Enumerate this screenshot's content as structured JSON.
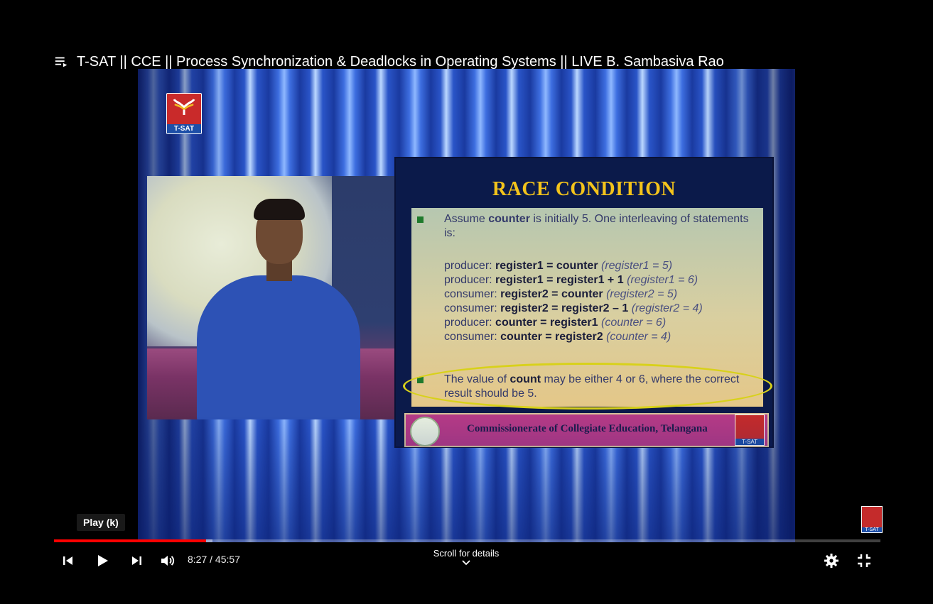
{
  "header": {
    "playlist_icon": "playlist-icon",
    "title": "T-SAT || CCE || Process Synchronization & Deadlocks in Operating Systems || LIVE B. Sambasiva Rao"
  },
  "video": {
    "channel_logo_label": "T-SAT",
    "slide": {
      "title": "RACE CONDITION",
      "intro_prefix": "Assume ",
      "intro_bold": "counter",
      "intro_suffix": " is initially 5. One interleaving of statements is:",
      "lines": [
        {
          "who": "producer: ",
          "stmt": "register1 = counter",
          "note": "(register1 = 5)"
        },
        {
          "who": "producer: ",
          "stmt": "register1 = register1 + 1",
          "note": "(register1 = 6)"
        },
        {
          "who": "consumer: ",
          "stmt": "register2 = counter",
          "note": "(register2 = 5)"
        },
        {
          "who": "consumer: ",
          "stmt": "register2 = register2 – 1",
          "note": "(register2 = 4)"
        },
        {
          "who": "producer: ",
          "stmt": "counter = register1",
          "note": "(counter = 6)"
        },
        {
          "who": "consumer: ",
          "stmt": "counter = register2",
          "note": "(counter = 4)"
        }
      ],
      "conclusion_prefix": "The value of ",
      "conclusion_bold": "count",
      "conclusion_suffix": " may be either 4 or 6, where the correct result should be 5.",
      "footer": "Commissionerate of Collegiate Education, Telangana",
      "footer_logo_label": "T-SAT"
    },
    "corner_logo_label": "T-SAT"
  },
  "tooltip": "Play (k)",
  "progress": {
    "played_fraction": 0.184,
    "buffered_fraction": 0.192
  },
  "controls": {
    "time": "8:27 / 45:57",
    "scroll_hint": "Scroll for details"
  },
  "colors": {
    "progress_played": "#ff0000",
    "slide_title": "#f3c31b"
  }
}
